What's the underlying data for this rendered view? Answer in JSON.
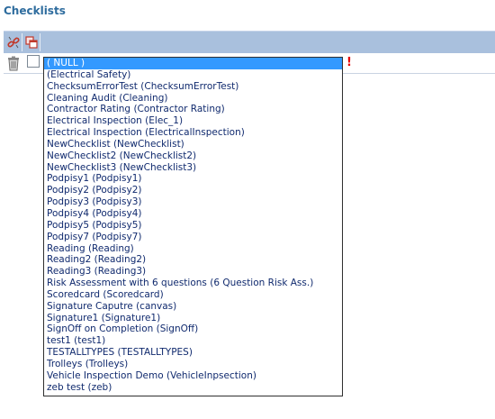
{
  "header": {
    "title": "Checklists"
  },
  "toolbar": {
    "buttons": [
      {
        "icon": "unlink-icon"
      },
      {
        "icon": "copy-window-icon"
      }
    ]
  },
  "row": {
    "delete_icon": "trash-icon",
    "checkbox_checked": false,
    "required_marker": "!"
  },
  "dropdown": {
    "selected_index": 0,
    "options": [
      "( NULL )",
      "(Electrical Safety)",
      "ChecksumErrorTest (ChecksumErrorTest)",
      "Cleaning Audit (Cleaning)",
      "Contractor Rating (Contractor Rating)",
      "Electrical Inspection (Elec_1)",
      "Electrical Inspection (ElectricalInspection)",
      "NewChecklist (NewChecklist)",
      "NewChecklist2 (NewChecklist2)",
      "NewChecklist3 (NewChecklist3)",
      "Podpisy1 (Podpisy1)",
      "Podpisy2 (Podpisy2)",
      "Podpisy3 (Podpisy3)",
      "Podpisy4 (Podpisy4)",
      "Podpisy5 (Podpisy5)",
      "Podpisy7 (Podpisy7)",
      "Reading (Reading)",
      "Reading2 (Reading2)",
      "Reading3 (Reading3)",
      "Risk Assessment with 6 questions (6 Question Risk Ass.)",
      "Scoredcard (Scoredcard)",
      "Signature Caputre (canvas)",
      "Signature1 (Signature1)",
      "SignOff on Completion (SignOff)",
      "test1 (test1)",
      "TESTALLTYPES (TESTALLTYPES)",
      "Trolleys (Trolleys)",
      "Vehicle Inspection Demo (VehicleInpsection)",
      "zeb test (zeb)"
    ]
  },
  "colors": {
    "title": "#2e6c9e",
    "toolbar": "#a9c0dd",
    "selection": "#3399ff",
    "option_text": "#102a6e",
    "required": "#e60000"
  }
}
